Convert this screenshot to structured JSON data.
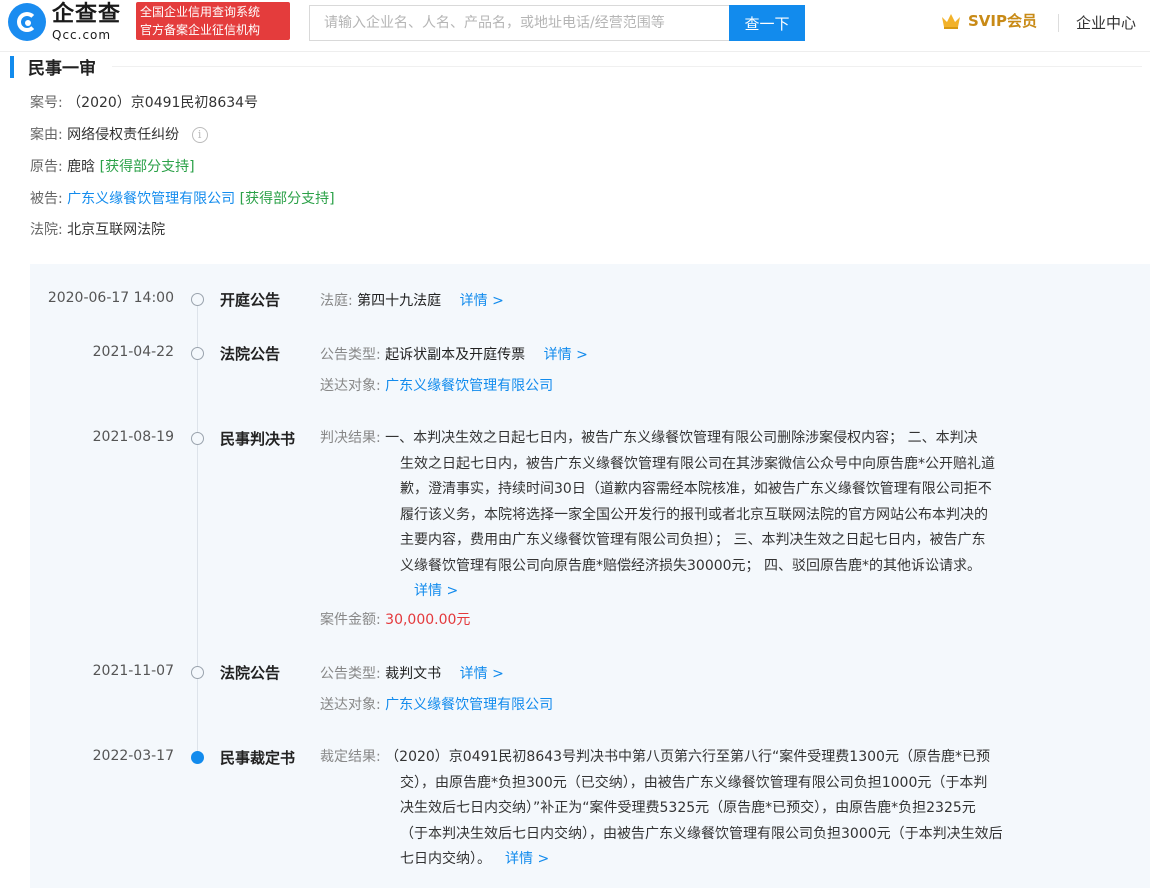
{
  "header": {
    "logo_cn": "企查查",
    "logo_en": "Qcc.com",
    "tag_line1": "全国企业信用查询系统",
    "tag_line2": "官方备案企业征信机构",
    "search_placeholder": "请输入企业名、人名、产品名，或地址电话/经营范围等",
    "search_button": "查一下",
    "svip": "SVIP会员",
    "enterprise_center": "企业中心"
  },
  "case": {
    "section_title": "民事一审",
    "case_no_label": "案号:",
    "case_no": "（2020）京0491民初8634号",
    "cause_label": "案由:",
    "cause": "网络侵权责任纠纷",
    "plaintiff_label": "原告:",
    "plaintiff": "鹿晗",
    "plaintiff_result": "[获得部分支持]",
    "defendant_label": "被告:",
    "defendant": "广东义缘餐饮管理有限公司",
    "defendant_result": "[获得部分支持]",
    "court_label": "法院:",
    "court": "北京互联网法院"
  },
  "timeline": [
    {
      "date": "2020-06-17 14:00",
      "type": "开庭公告",
      "k1": "法庭:",
      "v1": "第四十九法庭",
      "more": "详情 >"
    },
    {
      "date": "2021-04-22",
      "type": "法院公告",
      "k1": "公告类型:",
      "v1": "起诉状副本及开庭传票",
      "more": "详情 >",
      "k2": "送达对象:",
      "v2": "广东义缘餐饮管理有限公司"
    },
    {
      "date": "2021-08-19",
      "type": "民事判决书",
      "label": "判决结果:",
      "line1": "一、本判决生效之日起七日内，被告广东义缘餐饮管理有限公司删除涉案侵权内容； 二、本判决",
      "line2": "生效之日起七日内，被告广东义缘餐饮管理有限公司在其涉案微信公众号中向原告鹿*公开赔礼道",
      "line3": "歉，澄清事实，持续时间30日（道歉内容需经本院核准，如被告广东义缘餐饮管理有限公司拒不",
      "line4": "履行该义务，本院将选择一家全国公开发行的报刊或者北京互联网法院的官方网站公布本判决的",
      "line5": "主要内容，费用由广东义缘餐饮管理有限公司负担）； 三、本判决生效之日起七日内，被告广东",
      "line6": "义缘餐饮管理有限公司向原告鹿*赔偿经济损失30000元； 四、驳回原告鹿*的其他诉讼请求。",
      "more": "详情 >",
      "amount_label": "案件金额:",
      "amount": "30,000.00元"
    },
    {
      "date": "2021-11-07",
      "type": "法院公告",
      "k1": "公告类型:",
      "v1": "裁判文书",
      "more": "详情 >",
      "k2": "送达对象:",
      "v2": "广东义缘餐饮管理有限公司"
    },
    {
      "date": "2022-03-17",
      "type": "民事裁定书",
      "label": "裁定结果:",
      "line1": "（2020）京0491民初8643号判决书中第八页第六行至第八行“案件受理费1300元（原告鹿*已预",
      "line2": "交），由原告鹿*负担300元（已交纳），由被告广东义缘餐饮管理有限公司负担1000元（于本判",
      "line3": "决生效后七日内交纳）”补正为“案件受理费5325元（原告鹿*已预交），由原告鹿*负担2325元",
      "line4": "（于本判决生效后七日内交纳），由被告广东义缘餐饮管理有限公司负担3000元（于本判决生效后",
      "line5": "七日内交纳）。",
      "more": "详情 >"
    }
  ],
  "colors": {
    "accent": "#128bed",
    "green": "#2ba148",
    "red": "#e4393c",
    "tag_bg": "#e43c3c",
    "vip": "#c88a16",
    "panel_bg": "#f4f8fc"
  }
}
